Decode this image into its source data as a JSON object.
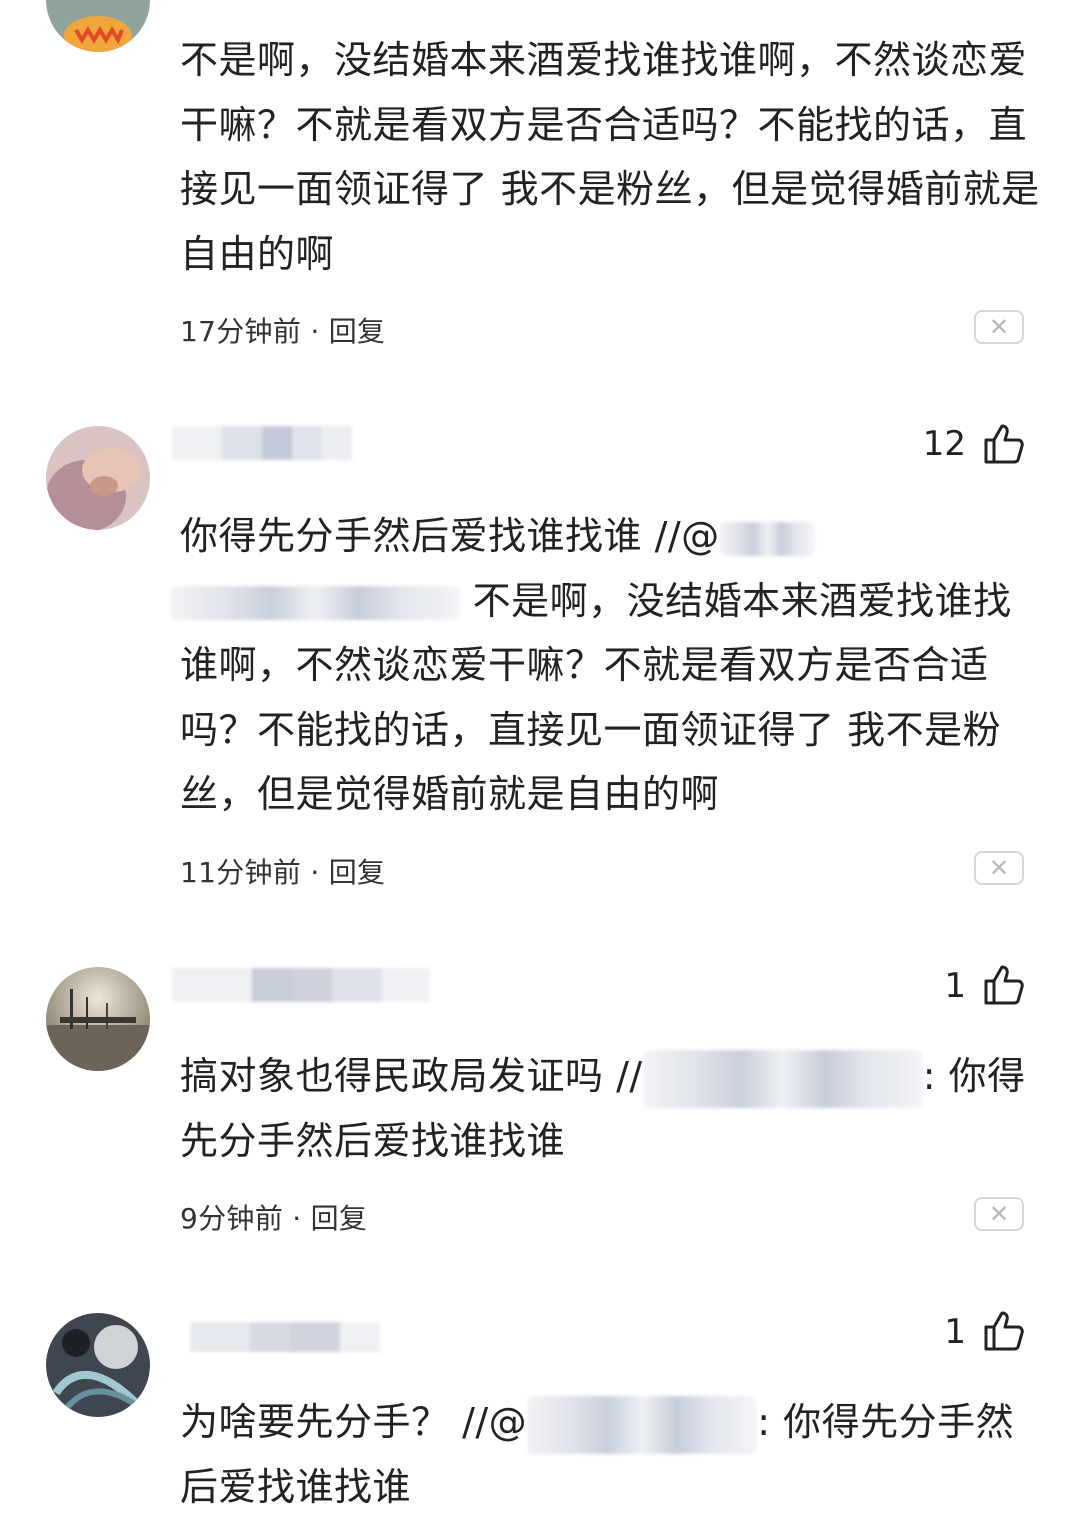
{
  "comments": [
    {
      "text": "不是啊，没结婚本来酒爱找谁找谁啊，不然谈恋爱干嘛？不就是看双方是否合适吗？不能找的话，直接见一面领证得了 我不是粉丝，但是觉得婚前就是自由的啊",
      "time": "17分钟前",
      "reply": "回复"
    },
    {
      "likes": "12",
      "text_prefix": "你得先分手然后爱找谁找谁 //@",
      "text_rest": " 不是啊，没结婚本来酒爱找谁找谁啊，不然谈恋爱干嘛？不就是看双方是否合适吗？不能找的话，直接见一面领证得了 我不是粉丝，但是觉得婚前就是自由的啊",
      "time": "11分钟前",
      "reply": "回复"
    },
    {
      "likes": "1",
      "text_prefix": "搞对象也得民政局发证吗 //",
      "text_suffix": ": 你得先分手然后爱找谁找谁",
      "time": "9分钟前",
      "reply": "回复"
    },
    {
      "likes": "1",
      "text_prefix": "为啥要先分手？ //@",
      "text_suffix": ": 你得先分手然后爱找谁找谁"
    }
  ],
  "meta_separator": "·",
  "close_glyph": "✕",
  "icons": {
    "like": "thumbs-up-icon",
    "close": "close-icon"
  },
  "colors": {
    "text": "#222222",
    "meta": "#333333",
    "border": "#d6d6d6",
    "mention": "#4a6ea9"
  }
}
